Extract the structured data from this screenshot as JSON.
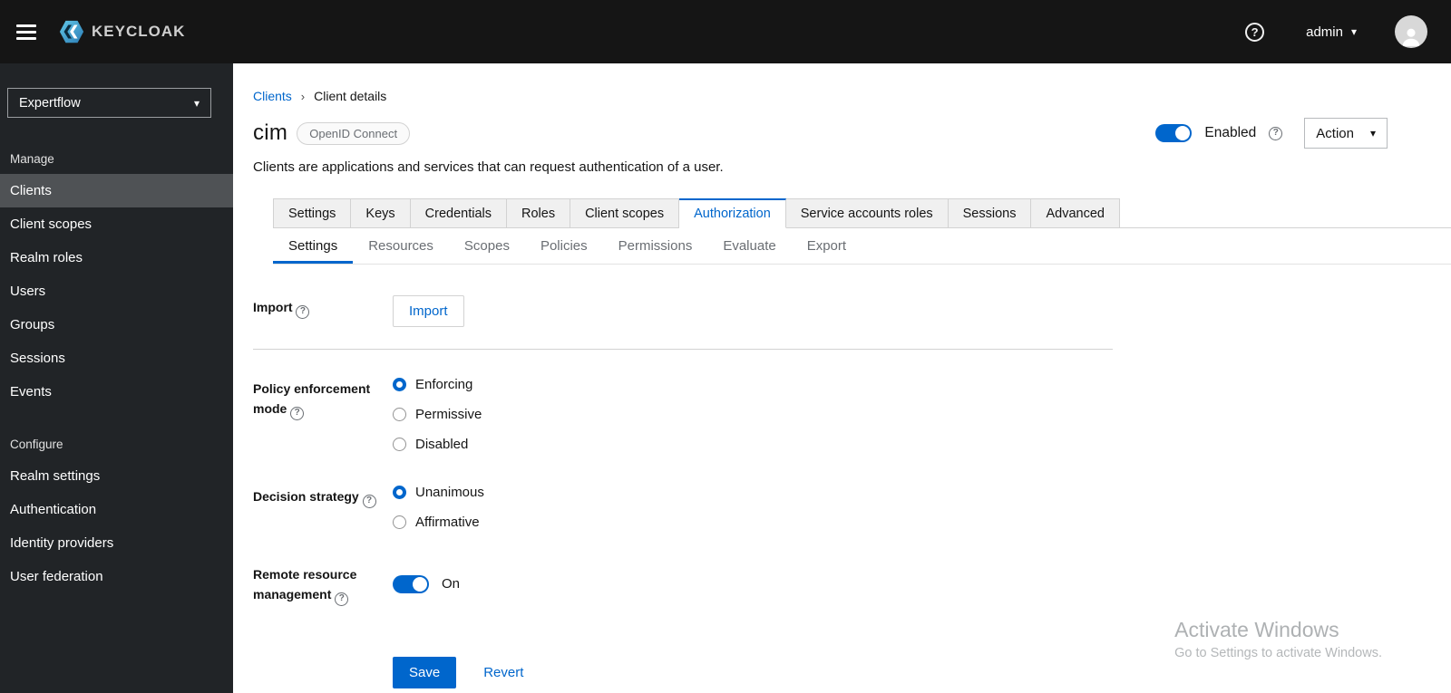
{
  "colors": {
    "primary": "#0066cc",
    "masthead": "#151515",
    "sidebar": "#212427"
  },
  "icons": {
    "caret_down": "▾",
    "help": "?"
  },
  "masthead": {
    "brand": "KEYCLOAK",
    "username": "admin"
  },
  "sidebar": {
    "realm_selector": {
      "value": "Expertflow"
    },
    "sections": [
      {
        "label": "Manage",
        "items": [
          {
            "label": "Clients",
            "active": true
          },
          {
            "label": "Client scopes"
          },
          {
            "label": "Realm roles"
          },
          {
            "label": "Users"
          },
          {
            "label": "Groups"
          },
          {
            "label": "Sessions"
          },
          {
            "label": "Events"
          }
        ]
      },
      {
        "label": "Configure",
        "items": [
          {
            "label": "Realm settings"
          },
          {
            "label": "Authentication"
          },
          {
            "label": "Identity providers"
          },
          {
            "label": "User federation"
          }
        ]
      }
    ]
  },
  "breadcrumb": {
    "items": [
      "Clients",
      "Client details"
    ],
    "separator": "›"
  },
  "page_header": {
    "title": "cim",
    "badge": "OpenID Connect",
    "description": "Clients are applications and services that can request authentication of a user.",
    "enabled_toggle_label": "Enabled",
    "action_dropdown_label": "Action"
  },
  "tabs": {
    "primary": {
      "items": [
        "Settings",
        "Keys",
        "Credentials",
        "Roles",
        "Client scopes",
        "Authorization",
        "Service accounts roles",
        "Sessions",
        "Advanced"
      ],
      "active": "Authorization"
    },
    "secondary": {
      "items": [
        "Settings",
        "Resources",
        "Scopes",
        "Policies",
        "Permissions",
        "Evaluate",
        "Export"
      ],
      "active": "Settings"
    }
  },
  "form": {
    "import": {
      "label": "Import",
      "button_label": "Import"
    },
    "policy_enforcement_mode": {
      "label": "Policy enforcement mode",
      "options": [
        "Enforcing",
        "Permissive",
        "Disabled"
      ],
      "selected": "Enforcing"
    },
    "decision_strategy": {
      "label": "Decision strategy",
      "options": [
        "Unanimous",
        "Affirmative"
      ],
      "selected": "Unanimous"
    },
    "remote_resource_management": {
      "label": "Remote resource management",
      "state_label": "On",
      "enabled": true
    },
    "actions": {
      "save": "Save",
      "revert": "Revert"
    }
  },
  "watermark": {
    "title": "Activate Windows",
    "subtitle": "Go to Settings to activate Windows."
  }
}
